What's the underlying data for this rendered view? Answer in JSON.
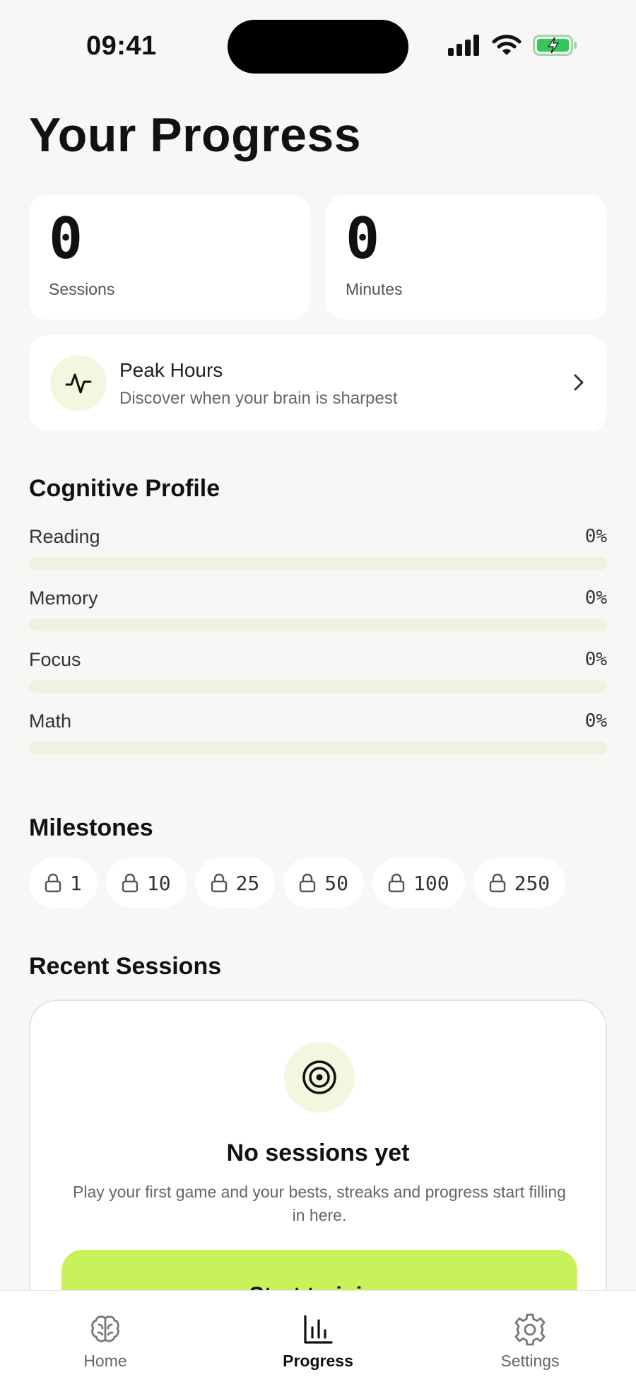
{
  "status_bar": {
    "time": "09:41"
  },
  "page": {
    "title": "Your Progress"
  },
  "stats": [
    {
      "value": "0",
      "label": "Sessions"
    },
    {
      "value": "0",
      "label": "Minutes"
    }
  ],
  "peak_hours": {
    "title": "Peak Hours",
    "subtitle": "Discover when your brain is sharpest"
  },
  "cognitive_profile": {
    "title": "Cognitive Profile",
    "items": [
      {
        "label": "Reading",
        "value_text": "0%",
        "value": 0
      },
      {
        "label": "Memory",
        "value_text": "0%",
        "value": 0
      },
      {
        "label": "Focus",
        "value_text": "0%",
        "value": 0
      },
      {
        "label": "Math",
        "value_text": "0%",
        "value": 0
      }
    ]
  },
  "milestones": {
    "title": "Milestones",
    "items": [
      "1",
      "10",
      "25",
      "50",
      "100",
      "250"
    ]
  },
  "recent_sessions": {
    "title": "Recent Sessions",
    "empty_title": "No sessions yet",
    "empty_subtitle": "Play your first game and your bests, streaks and progress start filling in here.",
    "button_label": "Start training"
  },
  "tabs": [
    {
      "label": "Home",
      "icon": "brain-icon",
      "active": false
    },
    {
      "label": "Progress",
      "icon": "bar-chart-icon",
      "active": true
    },
    {
      "label": "Settings",
      "icon": "gear-icon",
      "active": false
    }
  ],
  "colors": {
    "accent": "#c8f259",
    "accent_soft": "#f3f7df",
    "background": "#f7f7f5",
    "battery": "#34c759"
  }
}
